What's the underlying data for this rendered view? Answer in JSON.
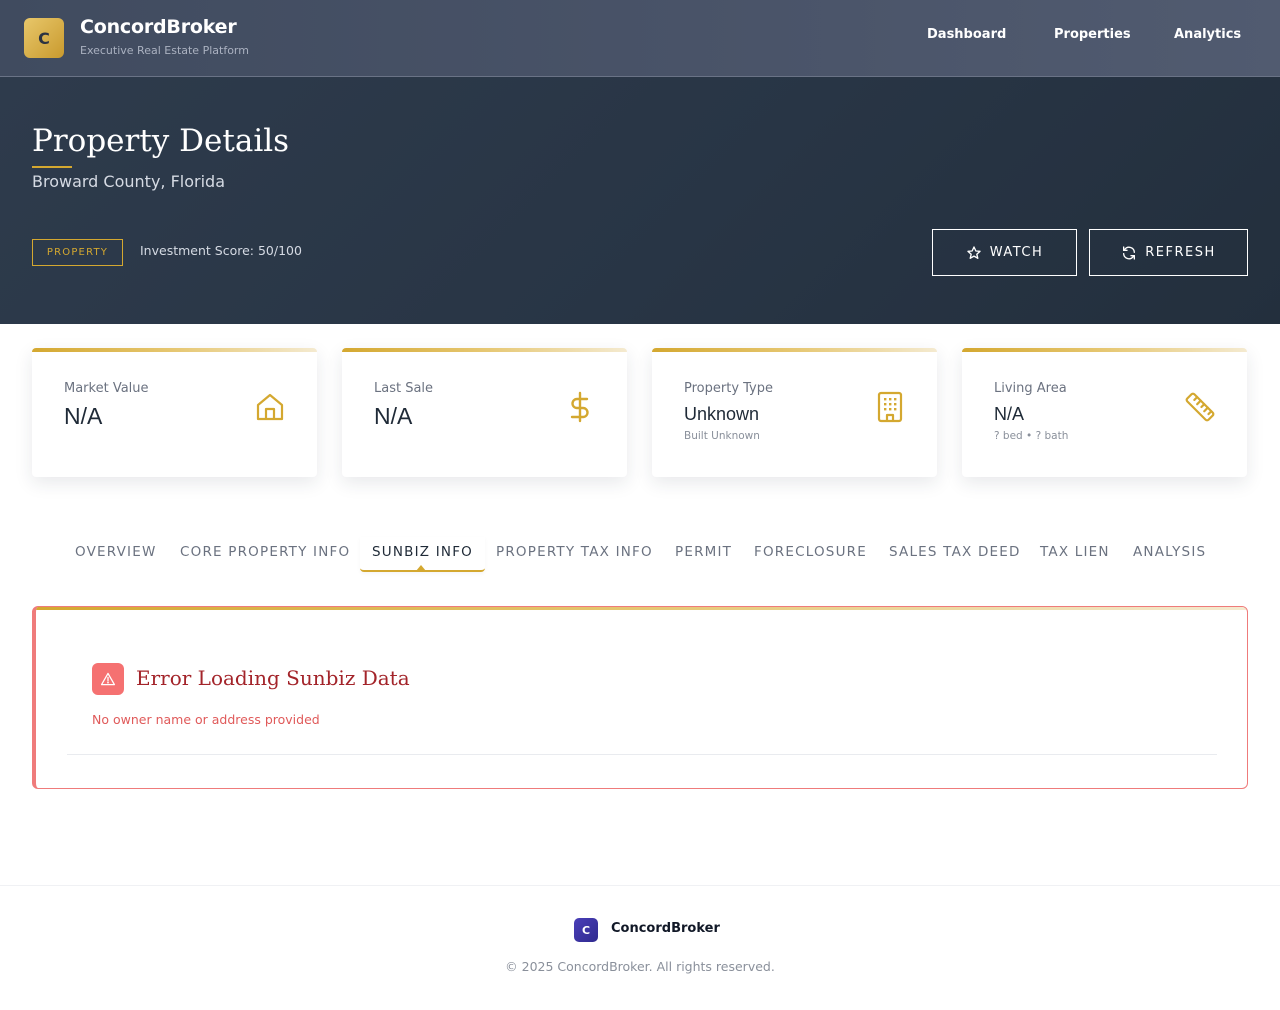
{
  "brand": {
    "logo_letter": "C",
    "name": "ConcordBroker",
    "tagline": "Executive Real Estate Platform"
  },
  "nav": {
    "items": [
      {
        "label": "Dashboard"
      },
      {
        "label": "Properties"
      },
      {
        "label": "Analytics"
      }
    ]
  },
  "hero": {
    "title": "Property Details",
    "subtitle": "Broward County, Florida",
    "badge": "PROPERTY",
    "investment_score": "Investment Score: 50/100",
    "watch_label": "WATCH",
    "refresh_label": "REFRESH"
  },
  "cards": [
    {
      "label": "Market Value",
      "value": "N/A",
      "icon": "home-icon"
    },
    {
      "label": "Last Sale",
      "value": "N/A",
      "icon": "dollar-icon"
    },
    {
      "label": "Property Type",
      "value": "Unknown",
      "note": "Built Unknown",
      "icon": "building-icon"
    },
    {
      "label": "Living Area",
      "value": "N/A",
      "note": "? bed • ? bath",
      "icon": "ruler-icon"
    }
  ],
  "tabs": [
    {
      "label": "OVERVIEW"
    },
    {
      "label": "CORE PROPERTY INFO"
    },
    {
      "label": "SUNBIZ INFO",
      "active": true
    },
    {
      "label": "PROPERTY TAX INFO"
    },
    {
      "label": "PERMIT"
    },
    {
      "label": "FORECLOSURE"
    },
    {
      "label": "SALES TAX DEED"
    },
    {
      "label": "TAX LIEN"
    },
    {
      "label": "ANALYSIS"
    }
  ],
  "error": {
    "title": "Error Loading Sunbiz Data",
    "message": "No owner name or address provided",
    "icon": "warning-icon"
  },
  "footer": {
    "logo_letter": "C",
    "name": "ConcordBroker",
    "copyright": "© 2025 ConcordBroker. All rights reserved."
  },
  "colors": {
    "accent_gold": "#d4a830",
    "hero_bg": "#2b3848",
    "nav_bg": "#465064",
    "error_red": "#ef7b7b",
    "error_title": "#a3242a"
  }
}
